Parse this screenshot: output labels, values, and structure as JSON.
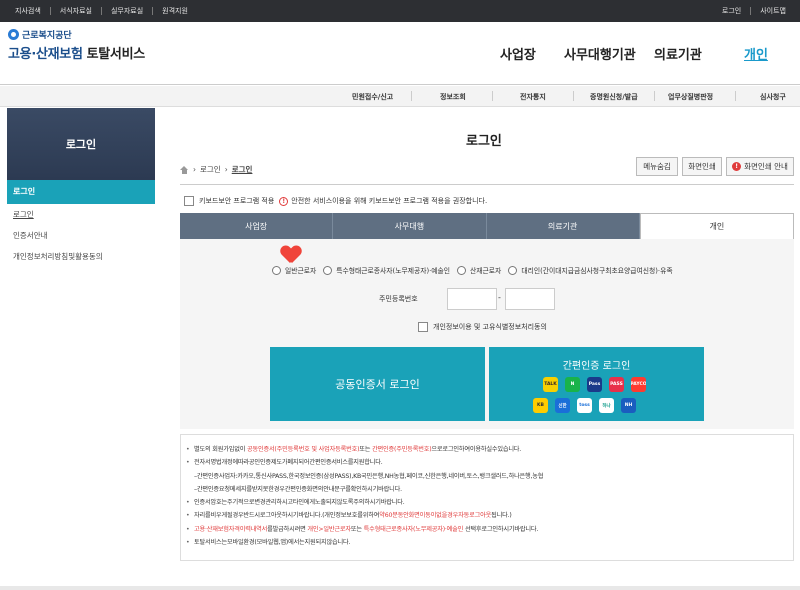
{
  "topbar": {
    "left": [
      "지사검색",
      "서식자료실",
      "실무자료실",
      "원격지원"
    ],
    "right": [
      "로그인",
      "사이트맵"
    ]
  },
  "header": {
    "org": "근로복지공단",
    "service_main": "고용·산재보험",
    "service_name": "토탈서비스",
    "nav": [
      "사업장",
      "사무대행기관",
      "의료기관",
      "개인"
    ],
    "active_nav": "개인",
    "active_color": "#1a9acb"
  },
  "subnav": [
    "민원접수/신고",
    "정보조회",
    "전자통지",
    "증명원신청/발급",
    "업무상질병판정",
    "심사청구"
  ],
  "sidebar": {
    "title": "로그인",
    "active": "로그인",
    "items": [
      "로그인",
      "인증서안내",
      "개인정보처리방침및활용동의"
    ]
  },
  "page": {
    "title": "로그인",
    "breadcrumb": [
      "로그인",
      "로그인"
    ],
    "buttons": {
      "menu_hide": "메뉴숨김",
      "print": "화면인쇄",
      "print_guide": "화면인쇄 안내"
    }
  },
  "keyboard": {
    "label": "키보드보안 프로그램 적용",
    "notice": "안전한 서비스이용을 위해 키보드보안 프로그램 적용을 권장합니다."
  },
  "tabs": [
    "사업장",
    "사무대행",
    "의료기관",
    "개인"
  ],
  "active_tab": "개인",
  "radios": [
    "일반근로자",
    "특수형태근로종사자(노무제공자)·예술인",
    "산재근로자",
    "대리인(간이대지급금심사청구최초요양급여신청)·유족"
  ],
  "rrn": {
    "label": "주민등록번호",
    "dash": "-"
  },
  "agree_label": "개인정보이용 및 고유식별정보처리동의",
  "login_buttons": {
    "cert": "공동인증서 로그인",
    "simple": "간편인증 로그인"
  },
  "simple_auth_icons": [
    {
      "name": "kakao-icon",
      "text": "TALK",
      "color": "#f7d000",
      "fg": "#3a2929"
    },
    {
      "name": "naver-icon",
      "text": "N",
      "color": "#19b34a",
      "fg": "#ffffff"
    },
    {
      "name": "samsung-pass-icon",
      "text": "Pass",
      "color": "#1a3a8a",
      "fg": "#ffffff"
    },
    {
      "name": "pass-icon",
      "text": "PASS",
      "color": "#e8304a",
      "fg": "#ffffff"
    },
    {
      "name": "payco-icon",
      "text": "PAYCO",
      "color": "#ff3b30",
      "fg": "#ffffff"
    },
    {
      "name": "kb-icon",
      "text": "KB",
      "color": "#ffcc00",
      "fg": "#333333"
    },
    {
      "name": "shinhan-icon",
      "text": "신한",
      "color": "#1a6fd8",
      "fg": "#ffffff"
    },
    {
      "name": "toss-icon",
      "text": "toss",
      "color": "#ffffff",
      "fg": "#1a6fd8"
    },
    {
      "name": "hana-icon",
      "text": "하나",
      "color": "#ffffff",
      "fg": "#0a9a88"
    },
    {
      "name": "nh-icon",
      "text": "NH",
      "color": "#1a5dbf",
      "fg": "#ffffff"
    }
  ],
  "info": [
    {
      "type": "bullet",
      "parts": [
        {
          "t": "별도의 회원가입없이 "
        },
        {
          "t": "공동인증서(주민등록번호 및 사업자등록번호)",
          "r": true
        },
        {
          "t": "또는 "
        },
        {
          "t": "간편인증(주민등록번호)",
          "r": true
        },
        {
          "t": "으로로그인하여이용하실수있습니다."
        }
      ]
    },
    {
      "type": "bullet",
      "parts": [
        {
          "t": "전자서명법개정에따라공인인증제도가폐지되어간편인증서비스를지원합니다."
        }
      ]
    },
    {
      "type": "sub",
      "parts": [
        {
          "t": "–간편인증사업자:카카오,통신사PASS,한국정보인증(삼성PASS),KB국민은행,NH농협,페이코,신한은행,네이버,토스,뱅크샐러드,하나은행,농협"
        }
      ]
    },
    {
      "type": "sub",
      "parts": [
        {
          "t": "–간편인증요청메세지를받지못한경우간편인증화면의안내문구를확인하시기바랍니다."
        }
      ]
    },
    {
      "type": "bullet",
      "parts": [
        {
          "t": "인증서암호는주기적으로변경관리하시고타인에게노출되지않도록주의하시기바랍니다."
        }
      ]
    },
    {
      "type": "bullet",
      "parts": [
        {
          "t": "자리를비우게될경우반드시로그아웃하시기바랍니다.(개인정보보호를위하여"
        },
        {
          "t": "약60분동안화면이동이없을경우자동로그아웃",
          "r": true
        },
        {
          "t": "됩니다.)"
        }
      ]
    },
    {
      "type": "bullet",
      "parts": [
        {
          "t": "고용·산재보험자격이력내역서",
          "r": true
        },
        {
          "t": "를발급하시려면 "
        },
        {
          "t": "개인>일반근로자",
          "r": true
        },
        {
          "t": "또는 "
        },
        {
          "t": "특수형태근로종사자(노무제공자)·예술인",
          "r": true
        },
        {
          "t": " 선택후로그인하시기바랍니다."
        }
      ]
    },
    {
      "type": "bullet",
      "parts": [
        {
          "t": "토탈서비스는모바일환경(모바일웹,앱)에서는지원되지않습니다."
        }
      ]
    }
  ]
}
